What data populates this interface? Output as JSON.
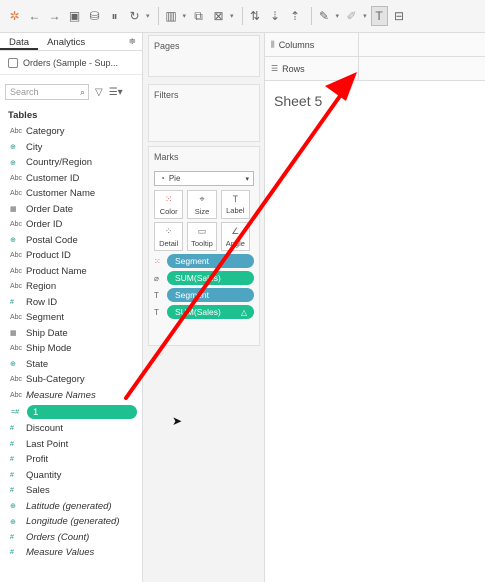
{
  "toolbar": {
    "buttons": [
      "tableau-logo-icon",
      "back-icon",
      "forward-icon",
      "save-icon",
      "new-datasource-icon",
      "pause-icon",
      "refresh-icon",
      "new-worksheet-icon",
      "duplicate-icon",
      "clear-icon",
      "swap-icon",
      "sort-asc-icon",
      "sort-desc-icon",
      "highlight-icon",
      "group-icon",
      "label-icon"
    ]
  },
  "datapane": {
    "tabs": {
      "data": "Data",
      "analytics": "Analytics"
    },
    "datasource": "Orders (Sample - Sup...",
    "search_placeholder": "Search",
    "tables_label": "Tables",
    "fields": [
      {
        "icon": "Abc",
        "name": "Category"
      },
      {
        "icon": "⊕",
        "name": "City"
      },
      {
        "icon": "⊕",
        "name": "Country/Region"
      },
      {
        "icon": "Abc",
        "name": "Customer ID"
      },
      {
        "icon": "Abc",
        "name": "Customer Name"
      },
      {
        "icon": "▦",
        "name": "Order Date"
      },
      {
        "icon": "Abc",
        "name": "Order ID"
      },
      {
        "icon": "⊕",
        "name": "Postal Code"
      },
      {
        "icon": "Abc",
        "name": "Product ID"
      },
      {
        "icon": "Abc",
        "name": "Product Name"
      },
      {
        "icon": "Abc",
        "name": "Region"
      },
      {
        "icon": "#",
        "name": "Row ID"
      },
      {
        "icon": "Abc",
        "name": "Segment"
      },
      {
        "icon": "▦",
        "name": "Ship Date"
      },
      {
        "icon": "Abc",
        "name": "Ship Mode"
      },
      {
        "icon": "⊕",
        "name": "State"
      },
      {
        "icon": "Abc",
        "name": "Sub-Category"
      },
      {
        "icon": "Abc",
        "name": "Measure Names"
      }
    ],
    "calc_pill": "1",
    "measures": [
      {
        "icon": "#",
        "name": "Discount"
      },
      {
        "icon": "#",
        "name": "Last Point"
      },
      {
        "icon": "#",
        "name": "Profit"
      },
      {
        "icon": "#",
        "name": "Quantity"
      },
      {
        "icon": "#",
        "name": "Sales"
      },
      {
        "icon": "⊕",
        "name": "Latitude (generated)"
      },
      {
        "icon": "⊕",
        "name": "Longitude (generated)"
      },
      {
        "icon": "#",
        "name": "Orders (Count)"
      },
      {
        "icon": "#",
        "name": "Measure Values"
      }
    ]
  },
  "shelves": {
    "pages": "Pages",
    "filters": "Filters",
    "marks": "Marks",
    "mark_type": "Pie",
    "buttons": [
      "Color",
      "Size",
      "Label",
      "Detail",
      "Tooltip",
      "Angle"
    ],
    "pills": [
      {
        "label": "Segment",
        "kind": "blue"
      },
      {
        "label": "SUM(Sales)",
        "kind": "green"
      },
      {
        "label": "Segment",
        "kind": "blue"
      },
      {
        "label": "SUM(Sales)",
        "kind": "green"
      }
    ]
  },
  "main": {
    "columns": "Columns",
    "rows": "Rows",
    "sheet_title": "Sheet 5"
  },
  "annotation": {
    "color": "#ff0000"
  }
}
